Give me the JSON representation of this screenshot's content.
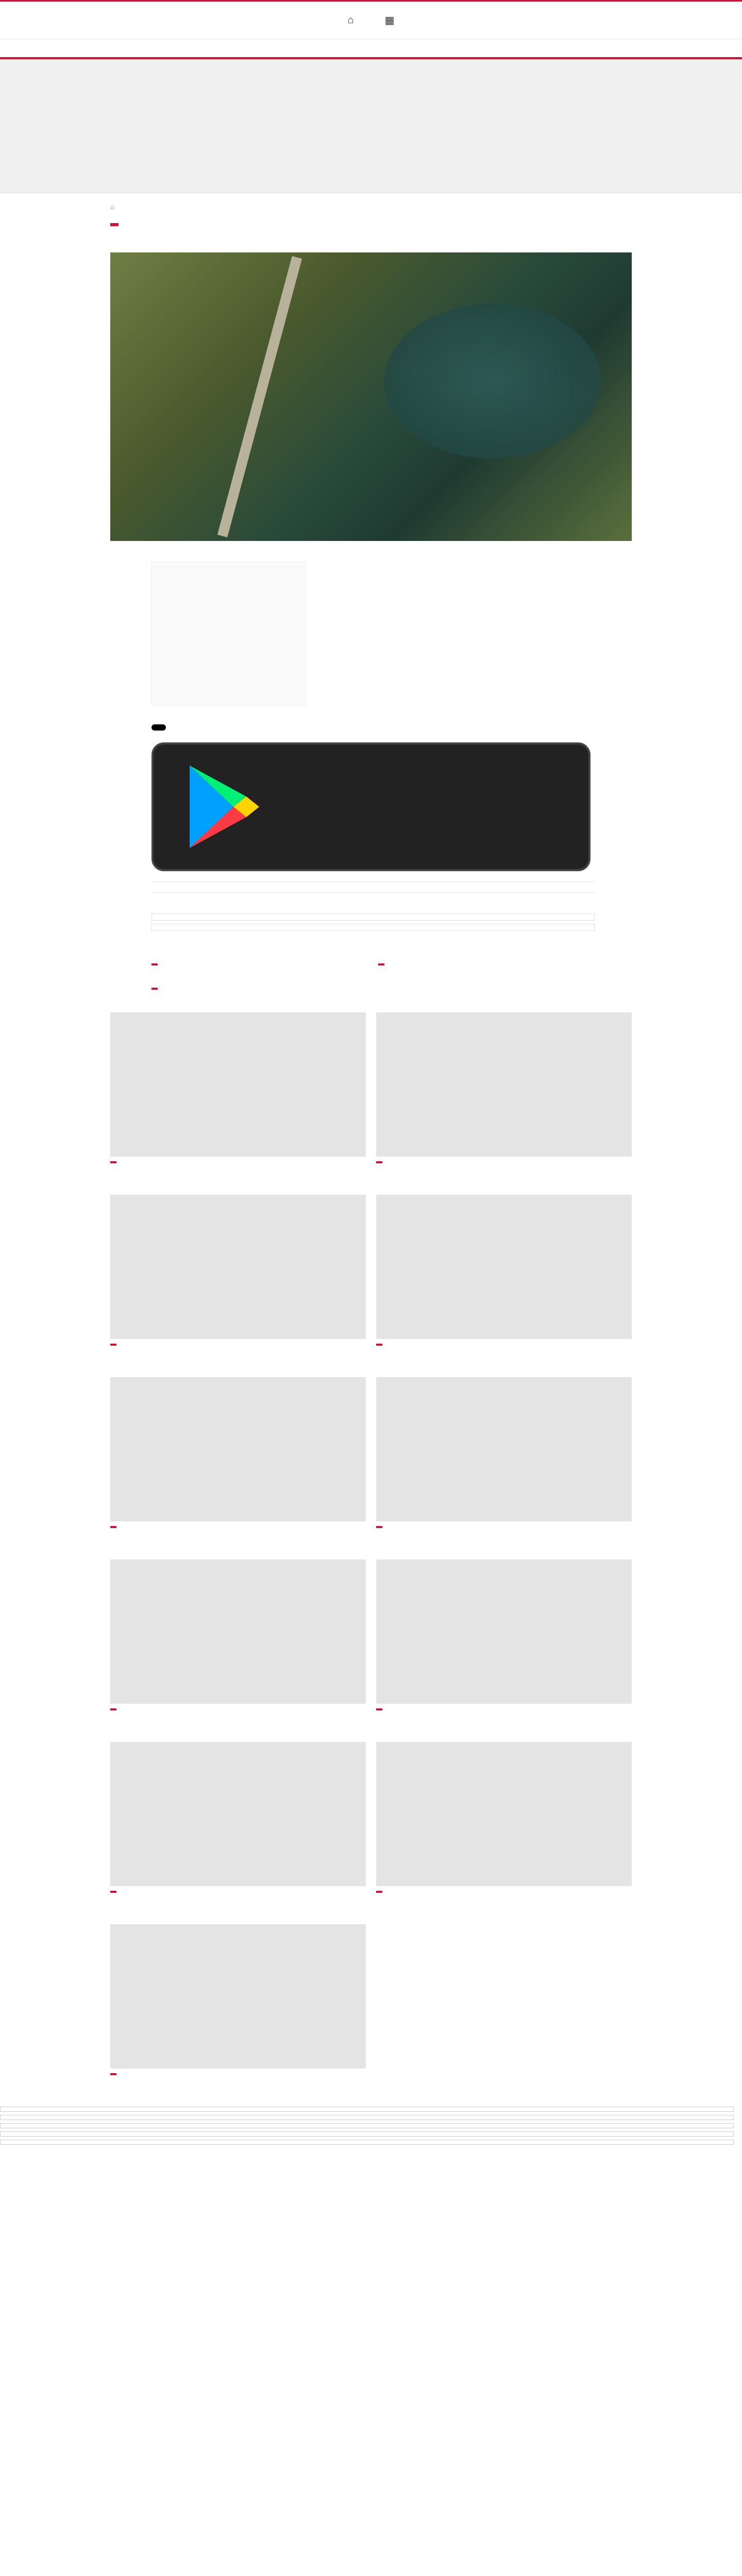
{
  "header": {
    "btn1": {
      "icon": "home-icon",
      "label": ""
    },
    "btn2": {
      "icon": "grid-icon",
      "label": ""
    }
  },
  "nav": [
    "",
    "",
    "",
    "",
    "",
    "",
    "",
    ""
  ],
  "breadcrumb": [
    "",
    ""
  ],
  "article": {
    "tag": "",
    "title": "",
    "lede": "",
    "meta": [
      "",
      "",
      ""
    ],
    "caption": "",
    "author": "",
    "player_label": "",
    "video_note": "",
    "paragraphs": [
      "",
      "",
      "",
      "",
      "",
      "",
      "",
      "",
      "",
      "",
      ""
    ],
    "ad_note": "",
    "download_text": "",
    "appstore": "",
    "gplay_line1": "",
    "gplay_line2": "",
    "share_label": ""
  },
  "related": {
    "title": "",
    "items": [
      "",
      ""
    ]
  },
  "more": {
    "section": "",
    "cards": [
      {
        "tag": "",
        "title": ""
      },
      {
        "tag": "",
        "title": ""
      },
      {
        "tag": "",
        "title": ""
      }
    ]
  },
  "other": {
    "title": "",
    "tiles": [
      {
        "tag": "",
        "title": ""
      },
      {
        "tag": "",
        "title": ""
      },
      {
        "tag": "",
        "title": ""
      },
      {
        "tag": "",
        "title": ""
      },
      {
        "tag": "",
        "title": ""
      },
      {
        "tag": "",
        "title": ""
      },
      {
        "tag": "",
        "title": ""
      },
      {
        "tag": "",
        "title": ""
      },
      {
        "tag": "",
        "title": ""
      },
      {
        "tag": "",
        "title": ""
      },
      {
        "tag": "",
        "title": ""
      }
    ]
  },
  "footer": {
    "lines": [
      "",
      "",
      "",
      "",
      "",
      "",
      "",
      "",
      "",
      "",
      "",
      "",
      "",
      "",
      "",
      "",
      "",
      "",
      "",
      "",
      "",
      "",
      "",
      "",
      "",
      "",
      "",
      "",
      "",
      ""
    ]
  },
  "colors": {
    "brand": "#d21034"
  }
}
